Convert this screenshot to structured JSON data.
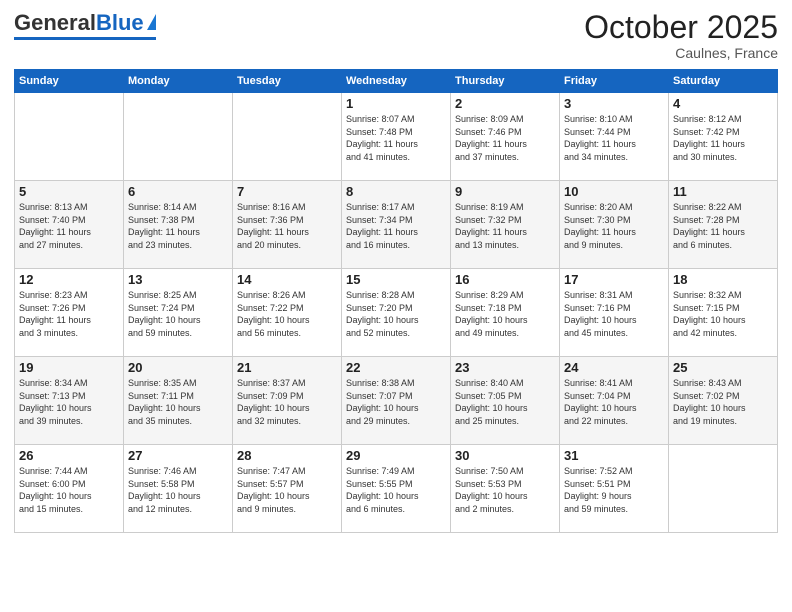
{
  "header": {
    "logo_general": "General",
    "logo_blue": "Blue",
    "month": "October 2025",
    "location": "Caulnes, France"
  },
  "weekdays": [
    "Sunday",
    "Monday",
    "Tuesday",
    "Wednesday",
    "Thursday",
    "Friday",
    "Saturday"
  ],
  "weeks": [
    [
      {
        "day": "",
        "info": ""
      },
      {
        "day": "",
        "info": ""
      },
      {
        "day": "",
        "info": ""
      },
      {
        "day": "1",
        "info": "Sunrise: 8:07 AM\nSunset: 7:48 PM\nDaylight: 11 hours\nand 41 minutes."
      },
      {
        "day": "2",
        "info": "Sunrise: 8:09 AM\nSunset: 7:46 PM\nDaylight: 11 hours\nand 37 minutes."
      },
      {
        "day": "3",
        "info": "Sunrise: 8:10 AM\nSunset: 7:44 PM\nDaylight: 11 hours\nand 34 minutes."
      },
      {
        "day": "4",
        "info": "Sunrise: 8:12 AM\nSunset: 7:42 PM\nDaylight: 11 hours\nand 30 minutes."
      }
    ],
    [
      {
        "day": "5",
        "info": "Sunrise: 8:13 AM\nSunset: 7:40 PM\nDaylight: 11 hours\nand 27 minutes."
      },
      {
        "day": "6",
        "info": "Sunrise: 8:14 AM\nSunset: 7:38 PM\nDaylight: 11 hours\nand 23 minutes."
      },
      {
        "day": "7",
        "info": "Sunrise: 8:16 AM\nSunset: 7:36 PM\nDaylight: 11 hours\nand 20 minutes."
      },
      {
        "day": "8",
        "info": "Sunrise: 8:17 AM\nSunset: 7:34 PM\nDaylight: 11 hours\nand 16 minutes."
      },
      {
        "day": "9",
        "info": "Sunrise: 8:19 AM\nSunset: 7:32 PM\nDaylight: 11 hours\nand 13 minutes."
      },
      {
        "day": "10",
        "info": "Sunrise: 8:20 AM\nSunset: 7:30 PM\nDaylight: 11 hours\nand 9 minutes."
      },
      {
        "day": "11",
        "info": "Sunrise: 8:22 AM\nSunset: 7:28 PM\nDaylight: 11 hours\nand 6 minutes."
      }
    ],
    [
      {
        "day": "12",
        "info": "Sunrise: 8:23 AM\nSunset: 7:26 PM\nDaylight: 11 hours\nand 3 minutes."
      },
      {
        "day": "13",
        "info": "Sunrise: 8:25 AM\nSunset: 7:24 PM\nDaylight: 10 hours\nand 59 minutes."
      },
      {
        "day": "14",
        "info": "Sunrise: 8:26 AM\nSunset: 7:22 PM\nDaylight: 10 hours\nand 56 minutes."
      },
      {
        "day": "15",
        "info": "Sunrise: 8:28 AM\nSunset: 7:20 PM\nDaylight: 10 hours\nand 52 minutes."
      },
      {
        "day": "16",
        "info": "Sunrise: 8:29 AM\nSunset: 7:18 PM\nDaylight: 10 hours\nand 49 minutes."
      },
      {
        "day": "17",
        "info": "Sunrise: 8:31 AM\nSunset: 7:16 PM\nDaylight: 10 hours\nand 45 minutes."
      },
      {
        "day": "18",
        "info": "Sunrise: 8:32 AM\nSunset: 7:15 PM\nDaylight: 10 hours\nand 42 minutes."
      }
    ],
    [
      {
        "day": "19",
        "info": "Sunrise: 8:34 AM\nSunset: 7:13 PM\nDaylight: 10 hours\nand 39 minutes."
      },
      {
        "day": "20",
        "info": "Sunrise: 8:35 AM\nSunset: 7:11 PM\nDaylight: 10 hours\nand 35 minutes."
      },
      {
        "day": "21",
        "info": "Sunrise: 8:37 AM\nSunset: 7:09 PM\nDaylight: 10 hours\nand 32 minutes."
      },
      {
        "day": "22",
        "info": "Sunrise: 8:38 AM\nSunset: 7:07 PM\nDaylight: 10 hours\nand 29 minutes."
      },
      {
        "day": "23",
        "info": "Sunrise: 8:40 AM\nSunset: 7:05 PM\nDaylight: 10 hours\nand 25 minutes."
      },
      {
        "day": "24",
        "info": "Sunrise: 8:41 AM\nSunset: 7:04 PM\nDaylight: 10 hours\nand 22 minutes."
      },
      {
        "day": "25",
        "info": "Sunrise: 8:43 AM\nSunset: 7:02 PM\nDaylight: 10 hours\nand 19 minutes."
      }
    ],
    [
      {
        "day": "26",
        "info": "Sunrise: 7:44 AM\nSunset: 6:00 PM\nDaylight: 10 hours\nand 15 minutes."
      },
      {
        "day": "27",
        "info": "Sunrise: 7:46 AM\nSunset: 5:58 PM\nDaylight: 10 hours\nand 12 minutes."
      },
      {
        "day": "28",
        "info": "Sunrise: 7:47 AM\nSunset: 5:57 PM\nDaylight: 10 hours\nand 9 minutes."
      },
      {
        "day": "29",
        "info": "Sunrise: 7:49 AM\nSunset: 5:55 PM\nDaylight: 10 hours\nand 6 minutes."
      },
      {
        "day": "30",
        "info": "Sunrise: 7:50 AM\nSunset: 5:53 PM\nDaylight: 10 hours\nand 2 minutes."
      },
      {
        "day": "31",
        "info": "Sunrise: 7:52 AM\nSunset: 5:51 PM\nDaylight: 9 hours\nand 59 minutes."
      },
      {
        "day": "",
        "info": ""
      }
    ]
  ]
}
